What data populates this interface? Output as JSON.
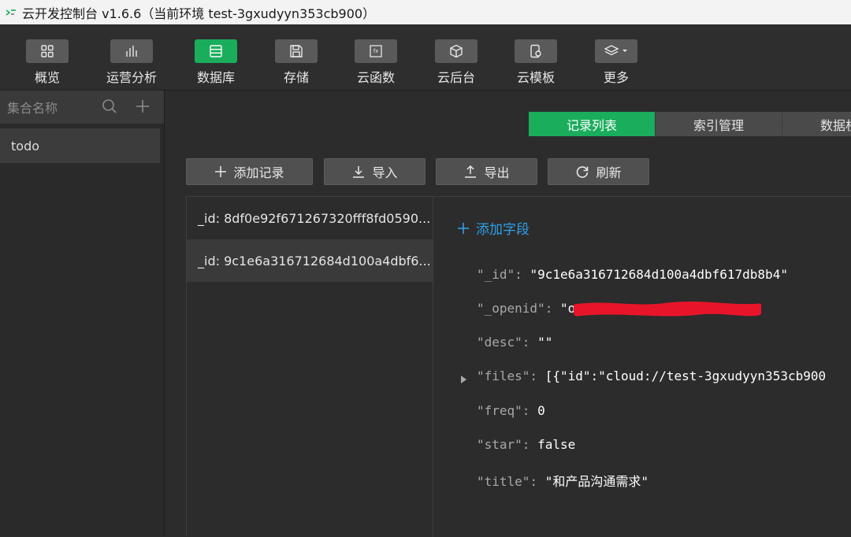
{
  "window": {
    "title": "云开发控制台 v1.6.6（当前环境 test-3gxudyyn353cb900）"
  },
  "toolbar": {
    "items": [
      {
        "label": "概览",
        "icon": "grid-icon"
      },
      {
        "label": "运营分析",
        "icon": "bar-chart-icon"
      },
      {
        "label": "数据库",
        "icon": "database-icon",
        "active": true
      },
      {
        "label": "存储",
        "icon": "save-icon"
      },
      {
        "label": "云函数",
        "icon": "function-icon"
      },
      {
        "label": "云后台",
        "icon": "cube-icon"
      },
      {
        "label": "云模板",
        "icon": "template-icon"
      },
      {
        "label": "更多",
        "icon": "layers-icon"
      }
    ]
  },
  "sidebar": {
    "header": "集合名称",
    "collections": [
      "todo"
    ]
  },
  "tabs": [
    {
      "label": "记录列表",
      "active": true
    },
    {
      "label": "索引管理"
    },
    {
      "label": "数据权限"
    }
  ],
  "actions": {
    "add_record": "添加记录",
    "import": "导入",
    "export": "导出",
    "refresh": "刷新"
  },
  "records": [
    {
      "label": "_id: 8df0e92f671267320fff8fd0590..."
    },
    {
      "label": "_id: 9c1e6a316712684d100a4dbf6...",
      "selected": true
    }
  ],
  "detail": {
    "add_field": "添加字段",
    "fields": [
      {
        "key": "\"_id\":",
        "value": "\"9c1e6a316712684d100a4dbf617db8b4\""
      },
      {
        "key": "\"_openid\":",
        "value": "\"o                            cxE\""
      },
      {
        "key": "\"desc\":",
        "value": "\"\""
      },
      {
        "key": "\"files\":",
        "value": "[{\"id\":\"cloud://test-3gxudyyn353cb900",
        "expandable": true
      },
      {
        "key": "\"freq\":",
        "value": "0"
      },
      {
        "key": "\"star\":",
        "value": "false"
      },
      {
        "key": "\"title\":",
        "value": "\"和产品沟通需求\""
      }
    ]
  },
  "colors": {
    "accent": "#1aad5c",
    "link": "#2f9fe8",
    "redaction": "#e8152a"
  }
}
